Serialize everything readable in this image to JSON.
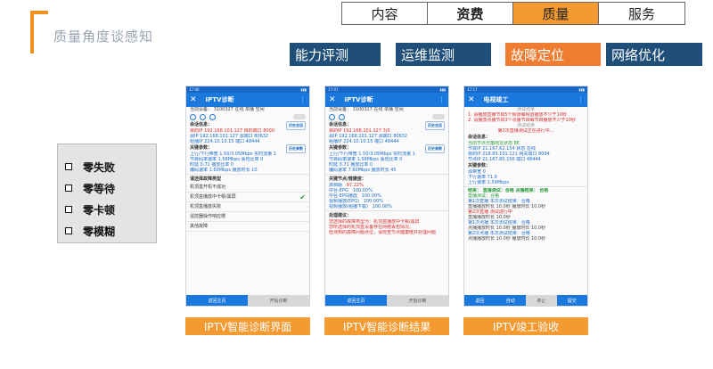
{
  "header": {
    "title": "质量角度谈感知",
    "tabs": [
      {
        "label": "内容",
        "active": false,
        "bold": false
      },
      {
        "label": "资费",
        "active": false,
        "bold": true
      },
      {
        "label": "质量",
        "active": true,
        "bold": false
      },
      {
        "label": "服务",
        "active": false,
        "bold": false
      }
    ]
  },
  "sub_tabs": [
    {
      "label": "能力评测",
      "color": "#1f4e79"
    },
    {
      "label": "运维监测",
      "color": "#1f4e79"
    },
    {
      "label": "故障定位",
      "color": "#ee7d31"
    },
    {
      "label": "网络优化",
      "color": "#1f4e79"
    }
  ],
  "sidebar": {
    "items": [
      "零失败",
      "零等待",
      "零卡顿",
      "零模糊"
    ]
  },
  "phones": [
    {
      "status_time": "17:06",
      "title": "IPTV诊断",
      "device_line": "当前设备： 3100327  在线  单播  空闲",
      "device_status": "在线",
      "section_meeting": "会话信息：",
      "meeting_btn": "历史会话",
      "meeting_rows": [
        "目的IP       192.168.101.127    目的端口  8000",
        "源IP         192.168.101.127   源端口   80632",
        "组播IP       224.10.10.15        端口    48444"
      ],
      "section_key": "关键参数：",
      "key_btn": "历史参数",
      "key_rows": [
        "上行/下行带宽   1.50/3.05Mbps  实时流量  1",
        "节目码率速率   1.58Mbps      丢包比率  0",
        "时延          0.71            播放比率  0",
        "编码速率       1.60Mbps      播放时长  10"
      ],
      "fault_title": "请选择故障类型",
      "fault_options": [
        "机顶盒开机不成功",
        "机顶盒播放中卡顿/黑屏",
        "机顶盒播放失败",
        "遥控器操作响应慢",
        "其他故障"
      ],
      "fault_checked": 1,
      "bottom": [
        {
          "label": "返回主页",
          "gray": false
        },
        {
          "label": "开始诊断",
          "gray": true
        }
      ]
    },
    {
      "status_time": "17:07",
      "title": "IPTV诊断",
      "device_line": "当前设备： 3100327  在线  单播  空闲",
      "device_status": "在线",
      "section_meeting": "会话信息：",
      "meeting_btn": "历史会话",
      "meeting_rows": [
        "目的IP       192.168.101.127    3/0      ",
        "源IP         192.168.101.127   源端口   80632",
        "组播IP       224.10.10.15        端口    48444"
      ],
      "section_key": "关键参数：",
      "key_btn": "历史参数",
      "key_rows": [
        "上行/下行带宽   1.50/3.05Mbps  实时流量  1",
        "节目码率速率   1.58Mbps      丢包比率  0",
        "时延          0.71            播放比率  0",
        "编码速率       7.60Mbps      播放时长  45"
      ],
      "health_title": "关键节点/健康度：",
      "health_rows": [
        [
          "高档版",
          "97.22%"
        ],
        [
          "中台-EPG",
          "100.00%"
        ],
        [
          "中台-EPG播放",
          "100.00%"
        ],
        [
          "视频播放(EPG)",
          "100.00%"
        ],
        [
          "视频播放(组播下载)",
          "100.00%"
        ]
      ],
      "result_title": "处理建议：",
      "result_lines": [
        "您选择的故障类型为：机顶盒播放中卡顿/黑屏",
        "您所选择的机顶盒设备存在网络丢包情况。",
        "检测到的故障问题点位，请检查节点健康度并处理问题"
      ],
      "bottom": [
        {
          "label": "返回主页",
          "gray": false
        },
        {
          "label": "开始诊断",
          "gray": true
        }
      ]
    },
    {
      "status_time": "17:17",
      "title": "电视竣工",
      "header_note": "测试结果",
      "test_lines": [
        "1. 请播放直播节目5个频道每频道播放不少于10秒",
        "2. 请播放点播节目3个点播节目每节目播放不少于10秒"
      ],
      "test_label": "测试结果",
      "warning": "第2次直播测试正在进行中...",
      "session_title": "会话信息：",
      "session_rows": [
        "当前节点光猫地址状态    8E",
        "节目IP     21.167.62.154     状态   在线",
        "目的IP     218.83.101.121   网关端口   8094",
        "节点IP     21.167.80.156    端口      48444"
      ],
      "key_title": "关键参数：",
      "key_rows": [
        "源带宽       0",
        "下行速率    71.9",
        "上行速率    1.59Mbps"
      ],
      "result_title": "结果： 直播测试：合格 点播结果： 合格",
      "result_sub": "直播测试：合格",
      "result_rows": [
        "第1次直播           本次测试结果：合格",
        "直播播放时长 10.0秒    播放时长 10.0秒",
        "第2次直播           测试进行中",
        "直播播放时长 10.0秒",
        "第1次点播           本次测试结果：合格",
        "点播播放时长 10.0秒    播放时长 10.0秒",
        "第2次点播           本次测试结果：合格",
        "点播播放时长 10.0秒    播放时长 10.0秒"
      ],
      "bottom": [
        {
          "label": "返回",
          "gray": false
        },
        {
          "label": "自动",
          "gray": false
        },
        {
          "label": "停止",
          "gray": true
        },
        {
          "label": "提交",
          "gray": false
        }
      ]
    }
  ],
  "captions": [
    "IPTV智能诊断界面",
    "IPTV智能诊断结果",
    "IPTV竣工验收"
  ],
  "colors": {
    "accent": "#f39a32",
    "navy": "#1f4e79",
    "app_blue": "#1b78dd"
  }
}
